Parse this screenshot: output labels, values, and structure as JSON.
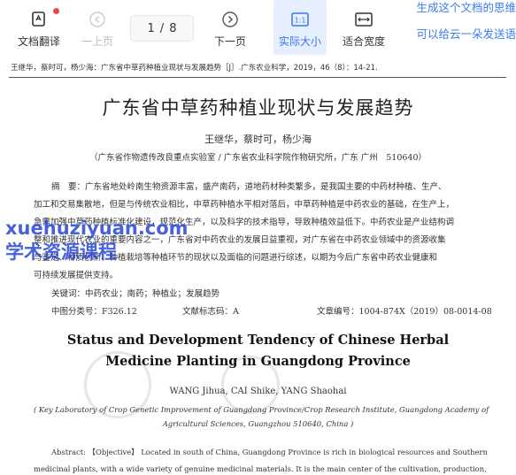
{
  "toolbar": {
    "translate_label": "文档翻译",
    "prev_label": "一上页",
    "page_current": "1",
    "page_sep": "/",
    "page_total": "8",
    "next_label": "下一页",
    "actual_size_label": "实际大小",
    "fit_width_label": "适合宽度"
  },
  "side_notes": {
    "line1": "生成这个文档的思维",
    "line2": "可以给云一朵发送语"
  },
  "document": {
    "citation": "王继华，蔡时可，杨少海：广东省中草药种植业现状与发展趋势［J］.广东农业科学，2019，46（8）：14-21.",
    "cn_title": "广东省中草药种植业现状与发展趋势",
    "cn_authors": "王继华，蔡时可，杨少海",
    "cn_affiliation": "（广东省作物遗传改良重点实验室 / 广东省农业科学院作物研究所，广东 广州　510640）",
    "abstract_lines": [
      "摘　要：广东省地处岭南生物资源丰富，盛产南药，道地药材种类繁多，是我国主要的中药材种植、生产、",
      "加工和交易集散地，但是与传统农业相比，中草药种植水平相对落后，中草药种植是中药农业的基础，在生产上，",
      "急需加强中草药种植标准化建设，规范化生产，以及科学的技术指导，导致种植效益低下。中药农业是产业结构调",
      "整和推进现代农业的重要内容之一，广东省对中药农业的发展日益重视，对广东省在中药农业领域中的资源收集",
      "与鉴定、种质创新、种植栽培等种植环节的现状以及面临的问题进行综述，以期为今后广东省中药农业健康和",
      "可持续发展提供支持。"
    ],
    "keywords": "关键词：中药农业；南药；种植业；发展趋势",
    "clc": "中图分类号：F326.12",
    "doc_code": "文献标志码：A",
    "article_no": "文章编号：1004-874X（2019）08-0014-08",
    "en_title_1": "Status and Development Tendency of Chinese Herbal",
    "en_title_2": "Medicine Planting in  Guangdong Province",
    "en_authors": "WANG Jihua, CAI Shike, YANG Shaohai",
    "en_affil_1": "( Key Laboratory of Crop Genetic Improvement of Guangdong Province/Crop Research Institute, Guangdong Academy of",
    "en_affil_2": "Agricultural Sciences, Guangzhou 510640, China )",
    "en_abstract_1": "Abstract: 【Objective】 Located in south of China, Guangdong Province is rich in biological resources and Southern",
    "en_abstract_2": "medicinal plants, with a wide variety of genuine medicinal materials. It is the main center of the cultivation, production,"
  },
  "watermark": {
    "line1": "xuehuziyuan.com",
    "line2": "学术资源课程"
  },
  "colors": {
    "accent": "#3a74f2",
    "active_bg": "#e6efff",
    "badge": "#f04848",
    "side_note": "#3a7bf0",
    "watermark": "#2746d8"
  }
}
